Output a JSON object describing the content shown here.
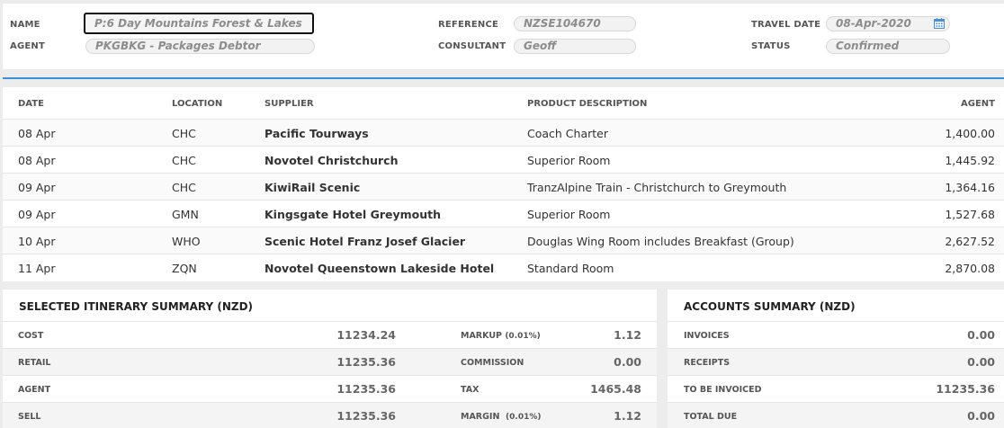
{
  "header": {
    "name_label": "NAME",
    "name_value": "P:6 Day Mountains Forest & Lakes",
    "agent_label": "AGENT",
    "agent_value": "PKGBKG - Packages Debtor",
    "reference_label": "REFERENCE",
    "reference_value": "NZSE104670",
    "consultant_label": "CONSULTANT",
    "consultant_value": "Geoff",
    "travel_date_label": "TRAVEL DATE",
    "travel_date_value": "08-Apr-2020",
    "status_label": "STATUS",
    "status_value": "Confirmed"
  },
  "itinerary": {
    "columns": [
      "DATE",
      "LOCATION",
      "SUPPLIER",
      "PRODUCT DESCRIPTION",
      "AGENT"
    ],
    "rows": [
      {
        "date": "08 Apr",
        "location": "CHC",
        "supplier": "Pacific Tourways",
        "description": "Coach Charter",
        "agent": "1,400.00"
      },
      {
        "date": "08 Apr",
        "location": "CHC",
        "supplier": "Novotel Christchurch",
        "description": "Superior Room",
        "agent": "1,445.92"
      },
      {
        "date": "09 Apr",
        "location": "CHC",
        "supplier": "KiwiRail Scenic",
        "description": "TranzAlpine Train - Christchurch to Greymouth",
        "agent": "1,364.16"
      },
      {
        "date": "09 Apr",
        "location": "GMN",
        "supplier": "Kingsgate Hotel Greymouth",
        "description": "Superior Room",
        "agent": "1,527.68"
      },
      {
        "date": "10 Apr",
        "location": "WHO",
        "supplier": "Scenic Hotel Franz Josef Glacier",
        "description": "Douglas Wing Room includes Breakfast (Group)",
        "agent": "2,627.52"
      },
      {
        "date": "11 Apr",
        "location": "ZQN",
        "supplier": "Novotel Queenstown Lakeside Hotel",
        "description": "Standard Room",
        "agent": "2,870.08"
      }
    ]
  },
  "itinerary_summary": {
    "title": "SELECTED ITINERARY SUMMARY (NZD)",
    "cost_label": "COST",
    "cost_value": "11234.24",
    "retail_label": "RETAIL",
    "retail_value": "11235.36",
    "agent_label": "AGENT",
    "agent_value": "11235.36",
    "sell_label": "SELL",
    "sell_value": "11235.36",
    "markup_label": "MARKUP",
    "markup_pct": "(0.01%)",
    "markup_value": "1.12",
    "commission_label": "COMMISSION",
    "commission_value": "0.00",
    "tax_label": "TAX",
    "tax_value": "1465.48",
    "margin_label": "MARGIN",
    "margin_pct": "(0.01%)",
    "margin_value": "1.12"
  },
  "accounts_summary": {
    "title": "ACCOUNTS SUMMARY (NZD)",
    "invoices_label": "INVOICES",
    "invoices_value": "0.00",
    "receipts_label": "RECEIPTS",
    "receipts_value": "0.00",
    "to_be_invoiced_label": "TO BE INVOICED",
    "to_be_invoiced_value": "11235.36",
    "total_due_label": "TOTAL DUE",
    "total_due_value": "0.00"
  },
  "colors": {
    "accent_line": "#3a8fd6",
    "calendar_icon": "#4a8fd6"
  },
  "icons": {
    "travel_date_picker": "calendar-icon"
  }
}
